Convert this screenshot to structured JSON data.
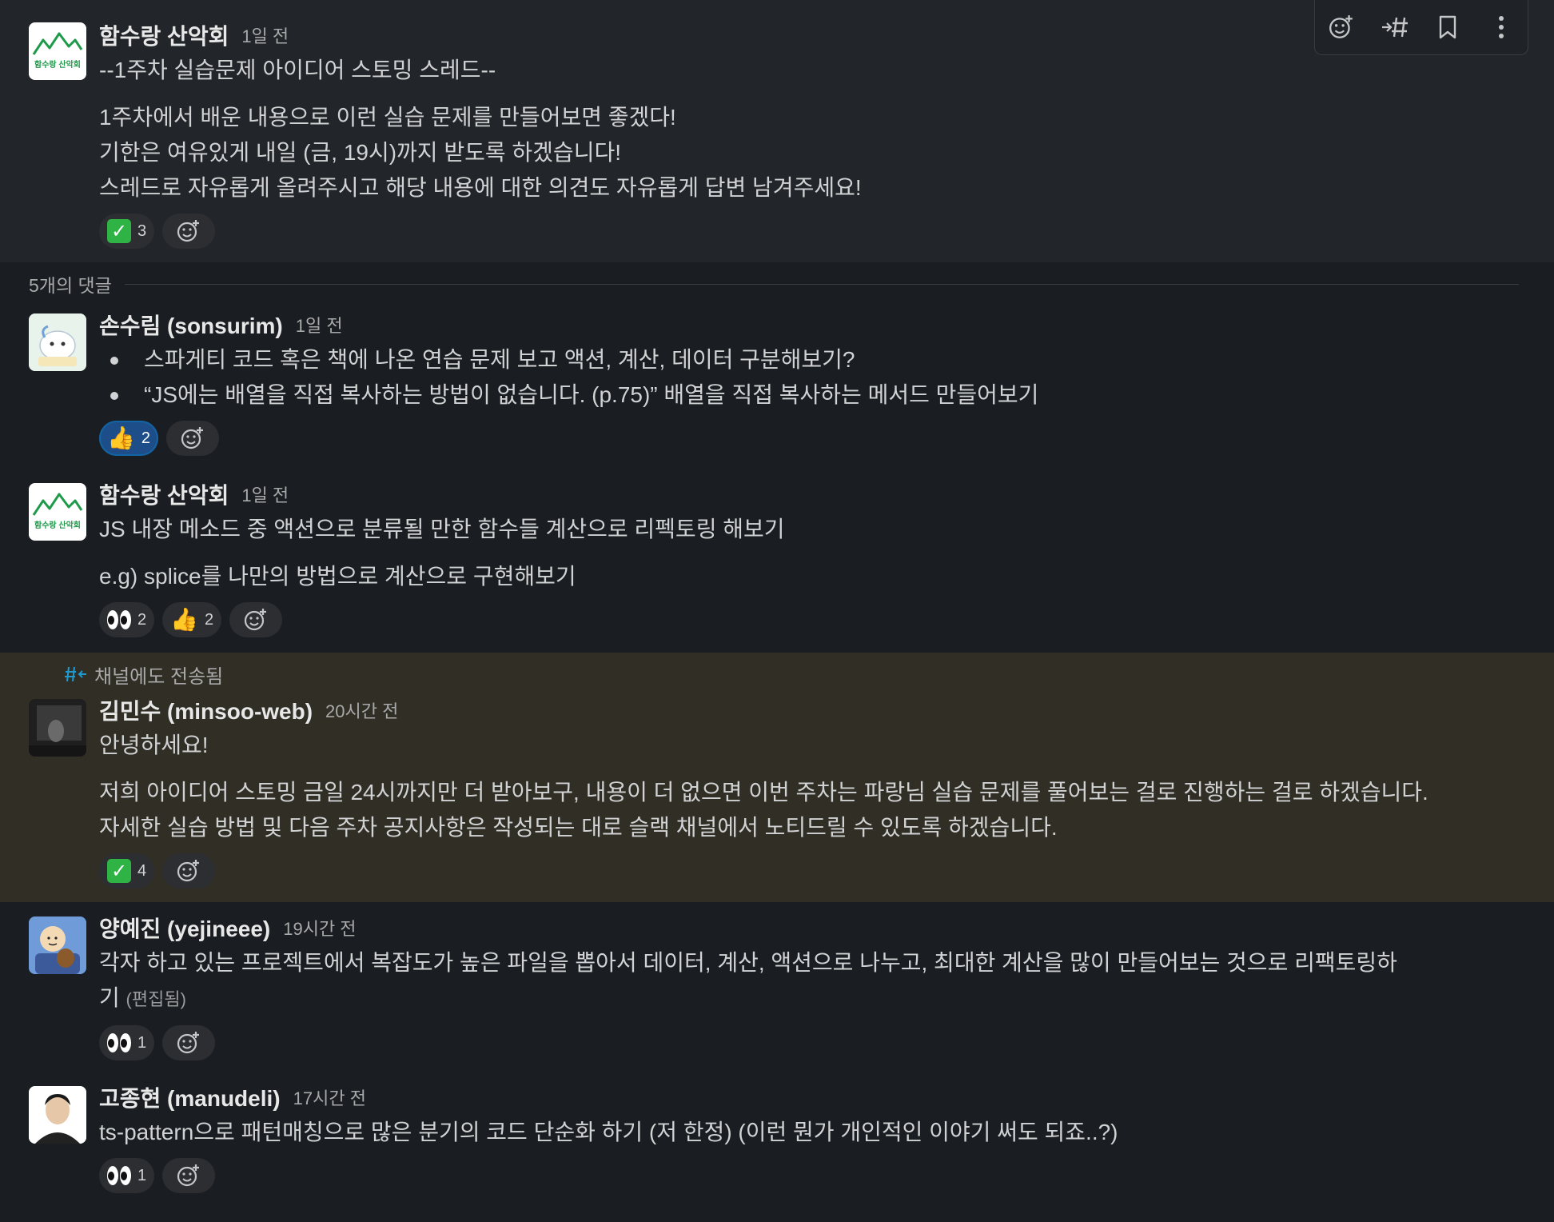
{
  "colors": {
    "background": "#1a1d21",
    "parent_bg": "#222529",
    "highlight_bg": "#312f25",
    "accent_blue": "#1264a3",
    "link_blue": "#1d9bd1"
  },
  "toolbar": {
    "add_reaction_icon": "add-reaction-icon",
    "forward_icon": "forward-to-channel-icon",
    "bookmark_icon": "bookmark-icon",
    "more_icon": "more-actions-icon"
  },
  "parent": {
    "author": "함수랑 산악회",
    "time": "1일 전",
    "avatar_text": "함수랑 산악회",
    "lines": [
      "--1주차 실습문제 아이디어 스토밍 스레드--",
      "1주차에서 배운 내용으로 이런 실습 문제를 만들어보면 좋겠다!",
      "기한은 여유있게 내일 (금, 19시)까지 받도록 하겠습니다!",
      "스레드로 자유롭게 올려주시고 해당 내용에 대한 의견도 자유롭게 답변 남겨주세요!"
    ],
    "reactions": [
      {
        "emoji": "check-mark-button",
        "count": "3"
      }
    ]
  },
  "replies_label": "5개의 댓글",
  "replies": [
    {
      "author": "손수림 (sonsurim)",
      "time": "1일 전",
      "bullets": [
        "스파게티 코드 혹은 책에 나온 연습 문제 보고 액션, 계산, 데이터 구분해보기?",
        "“JS에는 배열을 직접 복사하는 방법이 없습니다. (p.75)” 배열을 직접 복사하는 메서드 만들어보기"
      ],
      "reactions": [
        {
          "emoji": "thumbs-up",
          "count": "2",
          "active": true
        }
      ]
    },
    {
      "author": "함수랑 산악회",
      "time": "1일 전",
      "avatar_text": "함수랑 산악회",
      "lines": [
        "JS 내장 메소드 중 액션으로 분류될 만한 함수들 계산으로 리펙토링 해보기",
        "e.g) splice를 나만의 방법으로 계산으로 구현해보기"
      ],
      "reactions": [
        {
          "emoji": "eyes",
          "count": "2"
        },
        {
          "emoji": "thumbs-up",
          "count": "2"
        }
      ]
    },
    {
      "also_sent": "채널에도 전송됨",
      "author": "김민수 (minsoo-web)",
      "time": "20시간 전",
      "lines": [
        "안녕하세요!",
        "저희 아이디어 스토밍 금일 24시까지만 더 받아보구, 내용이 더 없으면 이번 주차는 파랑님 실습 문제를 풀어보는 걸로 진행하는 걸로 하겠습니다.",
        "자세한 실습 방법 및 다음 주차 공지사항은 작성되는 대로 슬랙 채널에서 노티드릴 수 있도록 하겠습니다."
      ],
      "reactions": [
        {
          "emoji": "check-mark-button",
          "count": "4"
        }
      ]
    },
    {
      "author": "양예진 (yejineee)",
      "time": "19시간 전",
      "lines": [
        "각자 하고 있는 프로젝트에서 복잡도가 높은 파일을 뽑아서 데이터, 계산, 액션으로 나누고, 최대한 계산을 많이 만들어보는 것으로 리팩토링하",
        "기"
      ],
      "edited": "(편집됨)",
      "reactions": [
        {
          "emoji": "eyes",
          "count": "1"
        }
      ]
    },
    {
      "author": "고종현 (manudeli)",
      "time": "17시간 전",
      "lines": [
        "ts-pattern으로 패턴매칭으로 많은 분기의 코드 단순화 하기 (저 한정) (이런 뭔가 개인적인 이야기 써도 되죠..?)"
      ],
      "reactions": [
        {
          "emoji": "eyes",
          "count": "1"
        }
      ]
    }
  ]
}
